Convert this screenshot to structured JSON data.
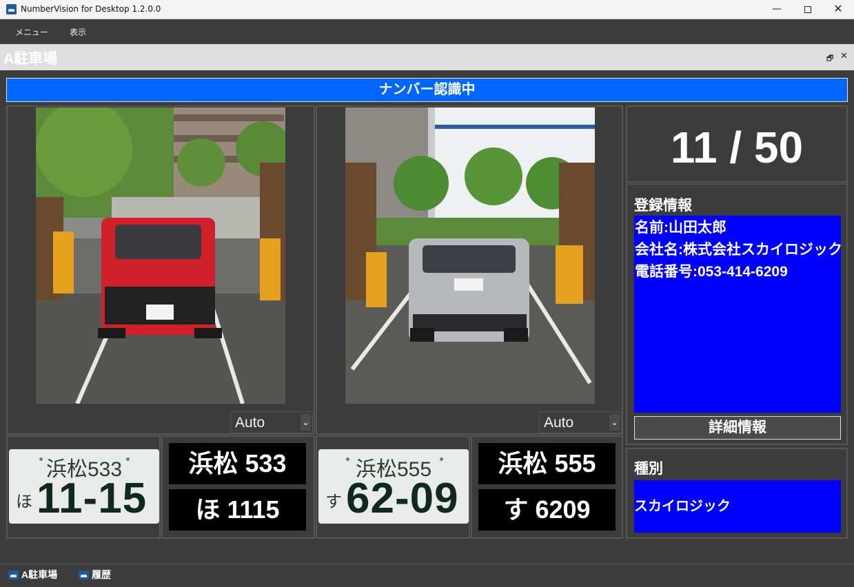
{
  "window": {
    "title": "NumberVision for Desktop 1.2.0.0",
    "controls": {
      "minimize": "—",
      "close": "✕"
    }
  },
  "menu": {
    "items": [
      "メニュー",
      "表示"
    ]
  },
  "document": {
    "title": "A駐車場",
    "restore_glyph": "🗗",
    "close_glyph": "✕"
  },
  "status": {
    "text": "ナンバー認識中",
    "color": "#0066ff"
  },
  "cameras": [
    {
      "mode": "Auto",
      "arrow": "⌄",
      "plate_image": {
        "top": "浜松533",
        "kana": "ほ",
        "number": "11-15"
      },
      "ocr": {
        "line1": "浜松 533",
        "line2": "ほ 1115"
      }
    },
    {
      "mode": "Auto",
      "arrow": "⌄",
      "plate_image": {
        "top": "浜松555",
        "kana": "す",
        "number": "62-09"
      },
      "ocr": {
        "line1": "浜松 555",
        "line2": "す 6209"
      }
    }
  ],
  "counter": {
    "text": "11 / 50"
  },
  "registration": {
    "heading": "登録情報",
    "lines": [
      "名前:山田太郎",
      "会社名:株式会社スカイロジック",
      "電話番号:053-414-6209"
    ],
    "detail_button": "詳細情報",
    "box_color": "#0000ff"
  },
  "category": {
    "heading": "種別",
    "value": "スカイロジック"
  },
  "bottom_tabs": [
    "A駐車場",
    "履歴"
  ]
}
